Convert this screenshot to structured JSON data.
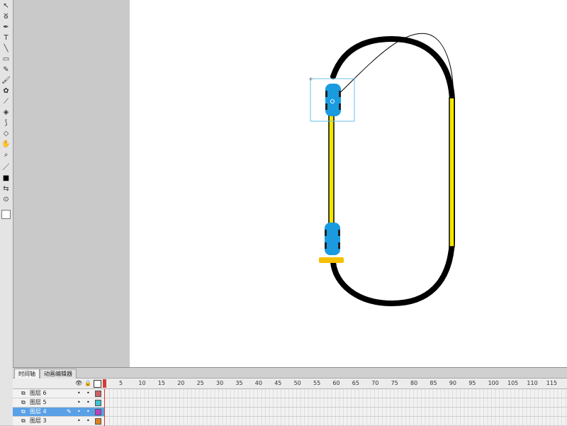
{
  "toolbar": {
    "tools": [
      {
        "name": "select-tool",
        "glyph": "↖"
      },
      {
        "name": "lasso-tool",
        "glyph": "ᘜ"
      },
      {
        "name": "pen-tool",
        "glyph": "✒"
      },
      {
        "name": "text-tool",
        "glyph": "T"
      },
      {
        "name": "line-tool",
        "glyph": "╲"
      },
      {
        "name": "rectangle-tool",
        "glyph": "▭"
      },
      {
        "name": "pencil-tool",
        "glyph": "✎"
      },
      {
        "name": "brush-tool",
        "glyph": "🖌"
      },
      {
        "name": "deco-tool",
        "glyph": "✿"
      },
      {
        "name": "bone-tool",
        "glyph": "⟋"
      },
      {
        "name": "paint-bucket-tool",
        "glyph": "◈"
      },
      {
        "name": "eyedropper-tool",
        "glyph": "⟆"
      },
      {
        "name": "eraser-tool",
        "glyph": "◇"
      },
      {
        "name": "hand-tool",
        "glyph": "✋"
      },
      {
        "name": "zoom-tool",
        "glyph": "⌕"
      },
      {
        "name": "stroke-color",
        "glyph": "／"
      },
      {
        "name": "fill-color",
        "glyph": "■"
      },
      {
        "name": "swap-colors",
        "glyph": "⇆"
      },
      {
        "name": "snap-option",
        "glyph": "⊙"
      }
    ],
    "stroke_color": "#000000",
    "fill_color": "#ffffff"
  },
  "stage": {
    "background": "#ffffff",
    "track_color": "#000000",
    "rail_color": "#f5e600",
    "car_color": "#1a9be0",
    "marker_color": "#f5c000",
    "selection_color": "#6cc0e8"
  },
  "timeline": {
    "tabs": [
      {
        "label": "时间轴",
        "active": true
      },
      {
        "label": "动画编辑器",
        "active": false
      }
    ],
    "frame_numbers": [
      "5",
      "10",
      "15",
      "20",
      "25",
      "30",
      "35",
      "40",
      "45",
      "50",
      "55",
      "60",
      "65",
      "70",
      "75",
      "80",
      "85",
      "90",
      "95",
      "100",
      "105",
      "110",
      "115"
    ],
    "layers": [
      {
        "name": "图层 6",
        "color": "#d06060",
        "selected": false
      },
      {
        "name": "图层 5",
        "color": "#40c0d0",
        "selected": false
      },
      {
        "name": "图层 4",
        "color": "#c040c0",
        "selected": true
      },
      {
        "name": "图层 3",
        "color": "#e08020",
        "selected": false
      }
    ]
  }
}
